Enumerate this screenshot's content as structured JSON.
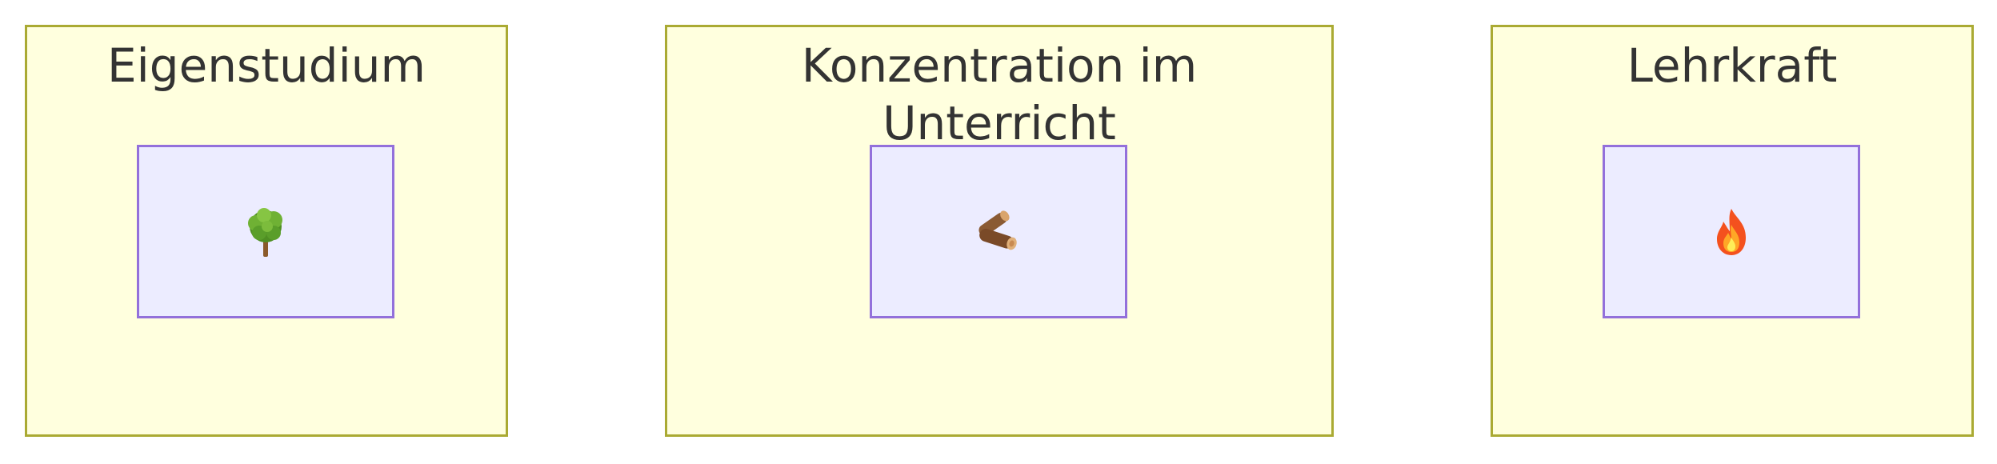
{
  "clusters": [
    {
      "title": "Eigenstudium",
      "node_icon": "deciduous-tree-icon"
    },
    {
      "title": "Konzentration im Unterricht",
      "node_icon": "wood-logs-icon"
    },
    {
      "title": "Lehrkraft",
      "node_icon": "fire-icon"
    }
  ],
  "colors": {
    "cluster_fill": "#ffffde",
    "cluster_border": "#aaaa33",
    "node_fill": "#ececff",
    "node_border": "#9370db",
    "text": "#333333"
  }
}
